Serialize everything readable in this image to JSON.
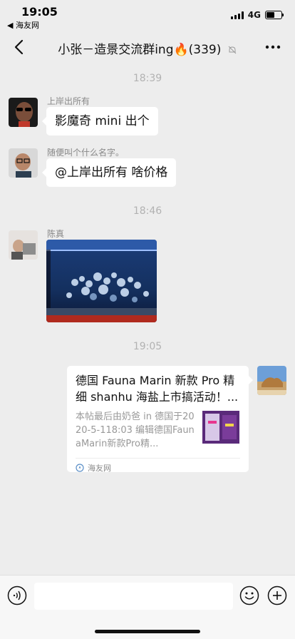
{
  "status": {
    "time": "19:05",
    "back_app": "◀ 海友网",
    "network": "4G",
    "battery_level": 0.55
  },
  "nav": {
    "title": "小张－造景交流群ing🔥(339)"
  },
  "messages": [
    {
      "type": "time",
      "text": "18:39"
    },
    {
      "type": "text",
      "sender": "上岸出所有",
      "text": "影魔奇 mini 出个"
    },
    {
      "type": "text",
      "sender": "随便叫个什么名字。",
      "text": "@上岸出所有 啥价格"
    },
    {
      "type": "time",
      "text": "18:46"
    },
    {
      "type": "image",
      "sender": "陈真"
    },
    {
      "type": "time",
      "text": "19:05"
    },
    {
      "type": "link_card",
      "title": "德国 Fauna Marin 新款 Pro 精细 shanhu 海盐上市搞活动！...",
      "description": "本帖最后由奶爸 in 德国于2020-5-118:03 编辑德国FaunaMarin新款Pro精...",
      "source": "海友网"
    }
  ],
  "input": {
    "value": "",
    "placeholder": ""
  },
  "colors": {
    "background": "#ededed",
    "bubble": "#ffffff",
    "time_text": "#b2b2b2",
    "sender_text": "#888888"
  }
}
